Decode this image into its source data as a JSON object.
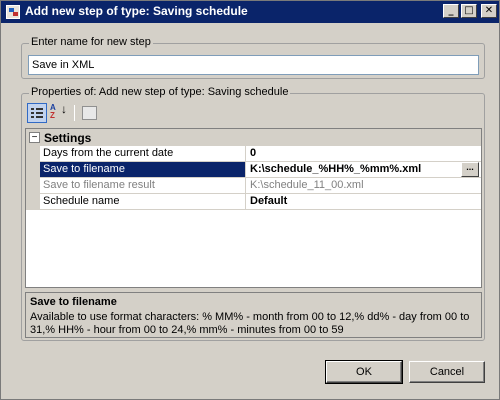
{
  "window": {
    "title": "Add new step of type: Saving schedule",
    "controls": {
      "minimize": "_",
      "maximize": "□",
      "close": "✕"
    }
  },
  "name_group": {
    "legend": "Enter name for new step",
    "value": "Save in XML"
  },
  "properties_group": {
    "legend": "Properties of: Add new step of type: Saving schedule",
    "toolbar": [
      {
        "name": "categorized-icon"
      },
      {
        "name": "sort-alphabetical-icon",
        "a": "A",
        "z": "Z",
        "arrow": "↓"
      },
      {
        "name": "property-pages-icon"
      }
    ],
    "category": {
      "expander": "−",
      "label": "Settings"
    },
    "rows": [
      {
        "name": "Days from the current date",
        "value": "0"
      },
      {
        "name": "Save to filename",
        "value": "K:\\schedule_%HH%_%mm%.xml",
        "selected": true,
        "ellipsis": "..."
      },
      {
        "name": "Save to filename result",
        "value": "K:\\schedule_11_00.xml",
        "readonly": true
      },
      {
        "name": "Schedule name",
        "value": "Default"
      }
    ],
    "help": {
      "title": "Save to filename",
      "description": "Available to use format characters: % MM% - month  from 00 to 12,% dd% - day from 00 to 31,% HH% - hour from 00 to 24,% mm% - minutes  from 00 to 59"
    }
  },
  "buttons": {
    "ok": "OK",
    "cancel": "Cancel"
  }
}
